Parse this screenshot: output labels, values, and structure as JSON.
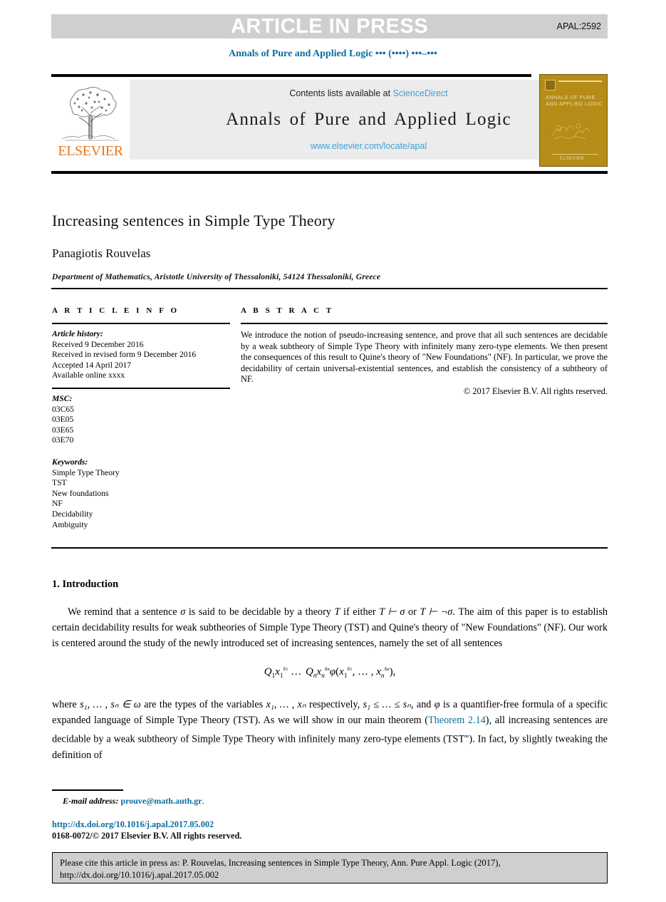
{
  "banner": {
    "press_text": "ARTICLE IN PRESS",
    "article_code": "APAL:2592",
    "banner_color": "#cfcfcf"
  },
  "running_head": "Annals of Pure and Applied Logic ••• (••••) •••–•••",
  "masthead": {
    "contents_prefix": "Contents lists available at",
    "sciencedirect": "ScienceDirect",
    "journal_title": "Annals of Pure and Applied Logic",
    "journal_url": "www.elsevier.com/locate/apal",
    "publisher": "ELSEVIER",
    "publisher_color": "#e87722",
    "link_color": "#3e9fd6",
    "cover": {
      "title": "ANNALS OF PURE AND APPLIED LOGIC",
      "footer": "ELSEVIER",
      "bg_color": "#b58c17"
    }
  },
  "title_block": {
    "title": "Increasing sentences in Simple Type Theory",
    "author": "Panagiotis Rouvelas",
    "affiliation": "Department of Mathematics, Aristotle University of Thessaloniki, 54124 Thessaloniki, Greece"
  },
  "article_info": {
    "heading": "A R T I C L E   I N F O",
    "history_label": "Article history:",
    "history": [
      "Received 9 December 2016",
      "Received in revised form 9 December 2016",
      "Accepted 14 April 2017",
      "Available online xxxx"
    ],
    "msc_label": "MSC:",
    "msc": [
      "03C65",
      "03E05",
      "03E65",
      "03E70"
    ],
    "keywords_label": "Keywords:",
    "keywords": [
      "Simple Type Theory",
      "TST",
      "New foundations",
      "NF",
      "Decidability",
      "Ambiguity"
    ]
  },
  "abstract": {
    "heading": "A B S T R A C T",
    "text": "We introduce the notion of pseudo-increasing sentence, and prove that all such sentences are decidable by a weak subtheory of Simple Type Theory with infinitely many zero-type elements. We then present the consequences of this result to Quine's theory of \"New Foundations\" (NF). In particular, we prove the decidability of certain universal-existential sentences, and establish the consistency of a subtheory of NF.",
    "copyright": "© 2017 Elsevier B.V. All rights reserved."
  },
  "introduction": {
    "heading": "1.  Introduction",
    "para1_a": "We remind that a sentence ",
    "para1_sigma": "σ",
    "para1_b": " is said to be decidable by a theory ",
    "para1_T": "T",
    "para1_c": " if either ",
    "para1_d": "T ⊢ σ",
    "para1_e": " or ",
    "para1_f": "T ⊢ ¬σ",
    "para1_g": ". The aim of this paper is to establish certain decidability results for weak subtheories of Simple Type Theory (TST) and Quine's theory of \"New Foundations\" (NF). Our work is centered around the study of the newly introduced set of increasing sentences, namely the set of all sentences",
    "formula": "Q₁x₁^{s₁} … Qₙxₙ^{sₙ} φ(x₁^{s₁}, … , xₙ^{sₙ}),",
    "para2_a": "where ",
    "para2_b": "s₁, … , sₙ ∈ ω",
    "para2_c": " are the types of the variables ",
    "para2_d": "x₁, … , xₙ",
    "para2_e": " respectively, ",
    "para2_f": "s₁ ≤ … ≤ sₙ",
    "para2_g": ", and ",
    "para2_h": "φ",
    "para2_i": " is a quantifier-free formula of a specific expanded language of Simple Type Theory (TST). As we will show in our main theorem (",
    "theorem_link": "Theorem 2.14",
    "para2_j": "), all increasing sentences are decidable by a weak subtheory of Simple Type Theory with infinitely many zero-type elements (TST",
    "para2_k": "∞",
    "para2_l": "). In fact, by slightly tweaking the definition of",
    "link_color": "#0b6d9e"
  },
  "footnote": {
    "email_label": "E-mail address:",
    "email": "prouve@math.auth.gr",
    "email_suffix": ".",
    "doi": "http://dx.doi.org/10.1016/j.apal.2017.05.002",
    "issn_line": "0168-0072/© 2017 Elsevier B.V. All rights reserved."
  },
  "cite_box": {
    "line1": "Please cite this article in press as: P. Rouvelas, Increasing sentences in Simple Type Theory, Ann. Pure Appl. Logic (2017),",
    "line2": "http://dx.doi.org/10.1016/j.apal.2017.05.002"
  }
}
